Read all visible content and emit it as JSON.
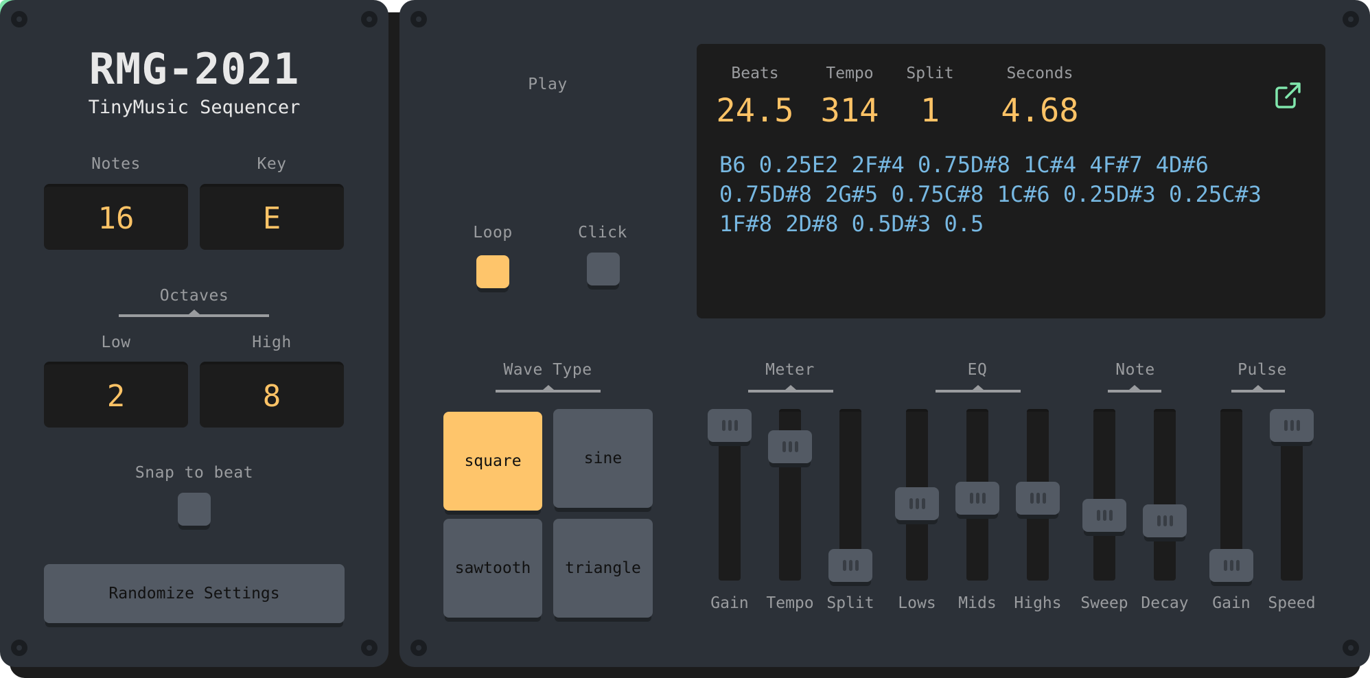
{
  "app": {
    "title": "RMG-2021",
    "subtitle": "TinyMusic Sequencer"
  },
  "left": {
    "notes": {
      "label": "Notes",
      "value": "16"
    },
    "key": {
      "label": "Key",
      "value": "E"
    },
    "octaves": {
      "group_label": "Octaves",
      "low": {
        "label": "Low",
        "value": "2"
      },
      "high": {
        "label": "High",
        "value": "8"
      }
    },
    "snap": {
      "label": "Snap to beat",
      "checked": false
    },
    "randomize_label": "Randomize Settings"
  },
  "transport": {
    "play_label": "Play",
    "play_icon": "play-icon",
    "loop": {
      "label": "Loop",
      "checked": true
    },
    "click": {
      "label": "Click",
      "checked": false
    }
  },
  "display": {
    "stats": [
      {
        "label": "Beats",
        "value": "24.5"
      },
      {
        "label": "Tempo",
        "value": "314"
      },
      {
        "label": "Split",
        "value": "1"
      },
      {
        "label": "Seconds",
        "value": "4.68"
      }
    ],
    "sequence_lines": [
      "B6 0.25E2 2F#4 0.75D#8 1C#4 4F#7 4D#6",
      "0.75D#8 2G#5 0.75C#8 1C#6 0.25D#3 0.25C#3",
      "1F#8 2D#8 0.5D#3 0.5"
    ],
    "open_icon": "external-link-icon"
  },
  "wave": {
    "group_label": "Wave Type",
    "options": [
      "square",
      "sine",
      "sawtooth",
      "triangle"
    ],
    "selected": "square"
  },
  "slider_groups": [
    {
      "label": "Meter"
    },
    {
      "label": "EQ"
    },
    {
      "label": "Note"
    },
    {
      "label": "Pulse"
    }
  ],
  "sliders": [
    {
      "group": "Meter",
      "label": "Gain",
      "value": 1.0
    },
    {
      "group": "Meter",
      "label": "Tempo",
      "value": 0.85
    },
    {
      "group": "Meter",
      "label": "Split",
      "value": 0.0
    },
    {
      "group": "EQ",
      "label": "Lows",
      "value": 0.44
    },
    {
      "group": "EQ",
      "label": "Mids",
      "value": 0.48
    },
    {
      "group": "EQ",
      "label": "Highs",
      "value": 0.48
    },
    {
      "group": "Note",
      "label": "Sweep",
      "value": 0.36
    },
    {
      "group": "Note",
      "label": "Decay",
      "value": 0.32
    },
    {
      "group": "Pulse",
      "label": "Gain",
      "value": 0.0
    },
    {
      "group": "Pulse",
      "label": "Speed",
      "value": 1.0
    }
  ],
  "colors": {
    "accent_orange": "#fec366",
    "play_green": "#80e6ac",
    "sequence_blue": "#77b8e2",
    "panel": "#2c3138"
  }
}
